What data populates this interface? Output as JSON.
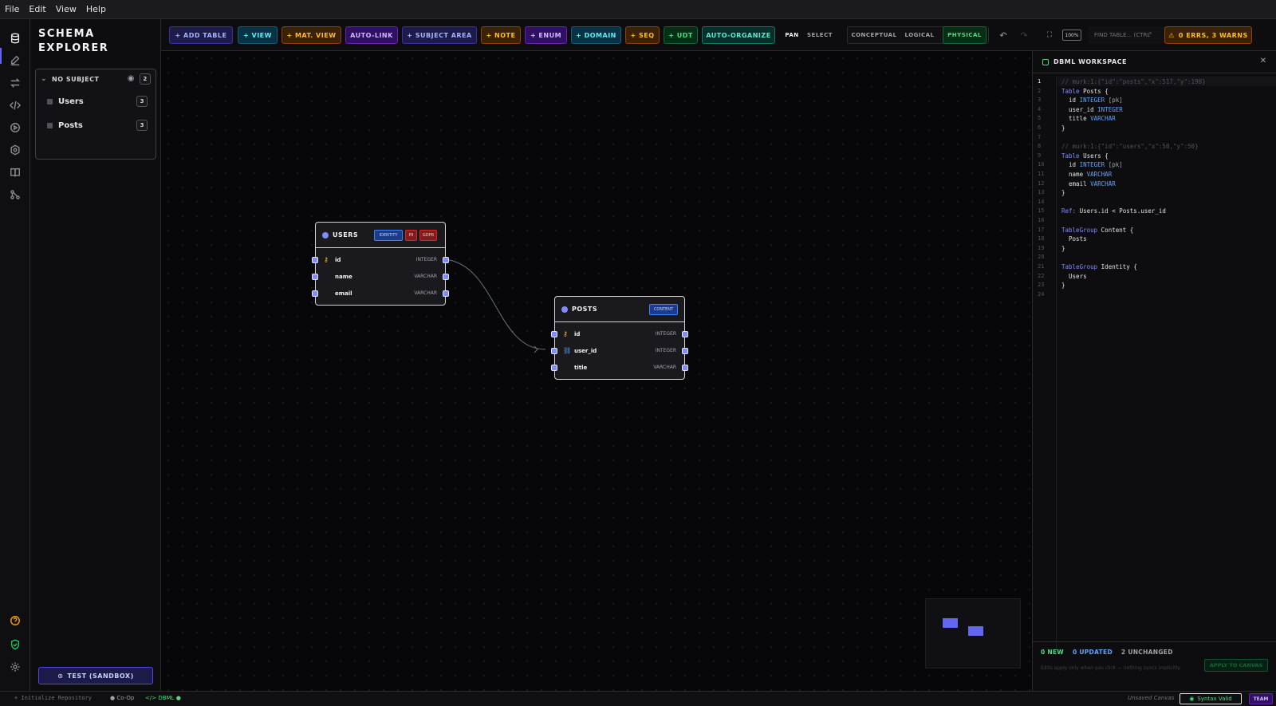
{
  "menu": [
    "File",
    "Edit",
    "View",
    "Help"
  ],
  "activity_icons": [
    "database-icon",
    "edit-icon",
    "swap-icon",
    "code-icon",
    "play-icon",
    "hexagon-icon",
    "book-icon",
    "git-icon",
    "help-icon",
    "shield-check-icon",
    "settings-icon"
  ],
  "sidebar": {
    "title": "SCHEMA EXPLORER",
    "subject": {
      "label": "NO SUBJECT",
      "count": "2",
      "items": [
        {
          "label": "Users",
          "count": "3"
        },
        {
          "label": "Posts",
          "count": "3"
        }
      ]
    },
    "test_button": "TEST (SANDBOX)"
  },
  "toolbar": {
    "add_table": "+ ADD TABLE",
    "view": "+ VIEW",
    "mat_view": "+ MAT. VIEW",
    "auto_link": "AUTO-LINK",
    "subject_area": "+ SUBJECT AREA",
    "note": "+ NOTE",
    "enum": "+ ENUM",
    "domain": "+ DOMAIN",
    "seq": "+ SEQ",
    "udt": "+ UDT",
    "auto_organize": "AUTO-ORGANIZE",
    "pan": "PAN",
    "select": "SELECT",
    "conceptual": "CONCEPTUAL",
    "logical": "LOGICAL",
    "physical": "PHYSICAL",
    "zoom": "100%",
    "find_placeholder": "FIND TABLE... (CTRL",
    "errors": "0 ERRS, 3 WARNS"
  },
  "canvas": {
    "tables": [
      {
        "name": "USERS",
        "tags": [
          "IDENTITY",
          "PII",
          "GDPR"
        ],
        "columns": [
          {
            "name": "id",
            "type": "INTEGER",
            "icon": "key-icon"
          },
          {
            "name": "name",
            "type": "VARCHAR",
            "icon": ""
          },
          {
            "name": "email",
            "type": "VARCHAR",
            "icon": ""
          }
        ]
      },
      {
        "name": "POSTS",
        "tags": [
          "CONTENT"
        ],
        "columns": [
          {
            "name": "id",
            "type": "INTEGER",
            "icon": "key-icon"
          },
          {
            "name": "user_id",
            "type": "INTEGER",
            "icon": "link-icon"
          },
          {
            "name": "title",
            "type": "VARCHAR",
            "icon": ""
          }
        ]
      }
    ]
  },
  "workspace": {
    "title": "DBML WORKSPACE",
    "code": [
      "// murk:1:{\"id\":\"posts\",\"x\":517,\"y\":198}",
      "Table Posts {",
      "  id INTEGER [pk]",
      "  user_id INTEGER",
      "  title VARCHAR",
      "}",
      "",
      "// murk:1:{\"id\":\"users\",\"x\":50,\"y\":50}",
      "Table Users {",
      "  id INTEGER [pk]",
      "  name VARCHAR",
      "  email VARCHAR",
      "}",
      "",
      "Ref: Users.id < Posts.user_id",
      "",
      "TableGroup Content {",
      "  Posts",
      "}",
      "",
      "TableGroup Identity {",
      "  Users",
      "}",
      ""
    ],
    "stats": {
      "new": "0 NEW",
      "updated": "0 UPDATED",
      "unchanged": "2 UNCHANGED"
    },
    "hint": "Edits apply only when you click — nothing syncs implicitly.",
    "apply": "APPLY TO CANVAS"
  },
  "statusbar": {
    "repo": "+ Initialize Repository",
    "coop": "Co-Op",
    "dbml": "DBML",
    "unsaved": "Unsaved Canvas",
    "syntax": "Syntax Valid",
    "team": "TEAM"
  },
  "colors": {
    "accent": "#6366f1",
    "ok": "#4ade80",
    "warn": "#fbbf24"
  }
}
